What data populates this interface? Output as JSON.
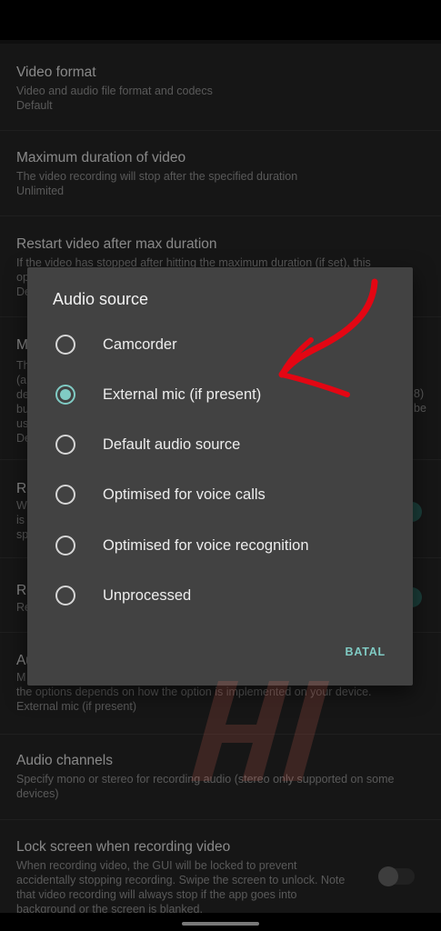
{
  "settings": {
    "video_format": {
      "title": "Video format",
      "summary": "Video and audio file format and codecs",
      "value": "Default"
    },
    "max_duration": {
      "title": "Maximum duration of video",
      "summary": "The video recording will stop after the specified duration",
      "value": "Unlimited"
    },
    "restart_video": {
      "title": "Restart video after max duration",
      "summary": "If the video has stopped after hitting the maximum duration (if set), this",
      "partial_2": "op",
      "partial_3": "De"
    },
    "partial_rows": {
      "m": "M",
      "th": "Th",
      "a": "(a",
      "de": "de",
      "bu": "bu",
      "us": "us",
      "de2": "De",
      "end_8": "8)",
      "end_be": "be",
      "re1": "Re",
      "wi": "W",
      "is": "is",
      "sp": "sp",
      "re2": "Re",
      "re3": "Re",
      "au": "Au",
      "mi": "M"
    },
    "audio_source": {
      "summary_tail": "the options depends on how the option is implemented on your device.",
      "value": "External mic (if present)"
    },
    "audio_channels": {
      "title": "Audio channels",
      "summary": "Specify mono or stereo for recording audio (stereo only supported on some devices)"
    },
    "lock_screen": {
      "title": "Lock screen when recording video",
      "summary": "When recording video, the GUI will be locked to prevent accidentally stopping recording. Swipe the screen to unlock. Note that video recording will always stop if the app goes into background or the screen is blanked."
    }
  },
  "dialog": {
    "title": "Audio source",
    "options": [
      {
        "label": "Camcorder",
        "selected": false
      },
      {
        "label": "External mic (if present)",
        "selected": true
      },
      {
        "label": "Default audio source",
        "selected": false
      },
      {
        "label": "Optimised for voice calls",
        "selected": false
      },
      {
        "label": "Optimised for voice recognition",
        "selected": false
      },
      {
        "label": "Unprocessed",
        "selected": false
      }
    ],
    "cancel_label": "BATAL"
  },
  "colors": {
    "accent": "#80cbc4",
    "dialog_bg": "#424242",
    "background": "#262626",
    "annotation_arrow": "#e30613"
  },
  "icons": {
    "annotation": "red-arrow-icon",
    "watermark": "hi-watermark-logo"
  }
}
